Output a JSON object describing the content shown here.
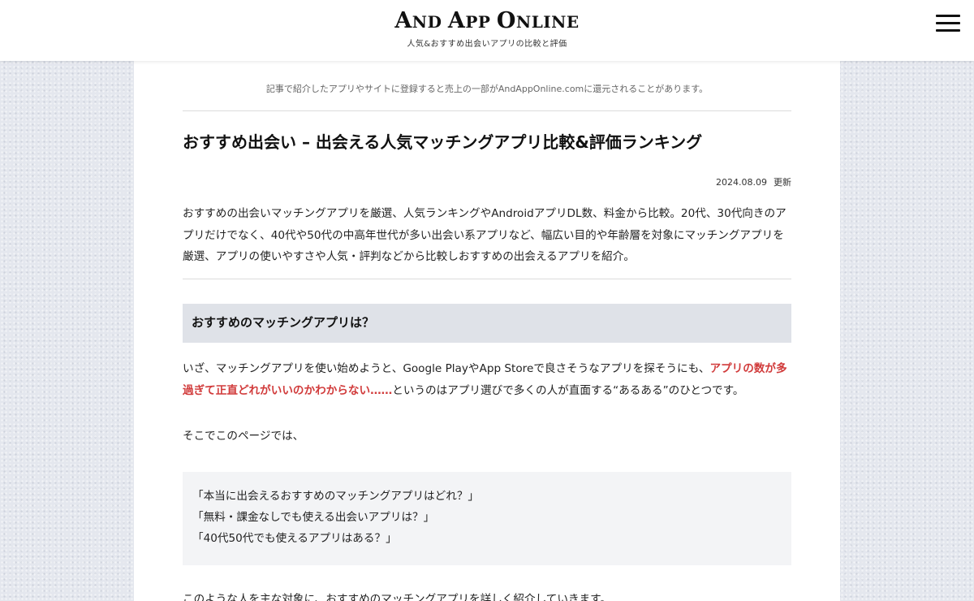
{
  "header": {
    "logo_a": "A",
    "logo_nd": "ND ",
    "logo_a2": "A",
    "logo_pp": "PP ",
    "logo_o": "O",
    "logo_nline": "NLINE",
    "tagline": "人気&おすすめ出会いアプリの比較と評価"
  },
  "article": {
    "disclosure": "記事で紹介したアプリやサイトに登録すると売上の一部がAndAppOnline.comに還元されることがあります。",
    "title": "おすすめ出会い – 出会える人気マッチングアプリ比較&評価ランキング",
    "updated_date": "2024.08.09",
    "updated_label": "更新",
    "intro": "おすすめの出会いマッチングアプリを厳選、人気ランキングやAndroidアプリDL数、料金から比較。20代、30代向きのアプリだけでなく、40代や50代の中高年世代が多い出会い系アプリなど、幅広い目的や年齢層を対象にマッチングアプリを厳選、アプリの使いやすさや人気・評判などから比較しおすすめの出会えるアプリを紹介。",
    "section_heading": "おすすめのマッチングアプリは？",
    "para1_before": "いざ、マッチングアプリを使い始めようと、Google PlayやApp Storeで良さそうなアプリを探そうにも、",
    "para1_emphasis": "アプリの数が多過ぎて正直どれがいいのかわからない……",
    "para1_after": "というのはアプリ選びで多くの人が直面する“あるある”のひとつです。",
    "para2": "そこでこのページでは、",
    "quotes": [
      "「本当に出会えるおすすめのマッチングアプリはどれ？」",
      "「無料・課金なしでも使える出会いアプリは？」",
      "「40代50代でも使えるアプリはある？」"
    ],
    "para3": "このような人を主な対象に、おすすめのマッチングアプリを詳しく紹介していきます。"
  },
  "colors": {
    "emphasis": "#d13b3b",
    "heading_bg": "#dfe2e8",
    "quote_bg": "#f3f4f6"
  },
  "icons": {
    "menu": "hamburger-menu-icon"
  }
}
